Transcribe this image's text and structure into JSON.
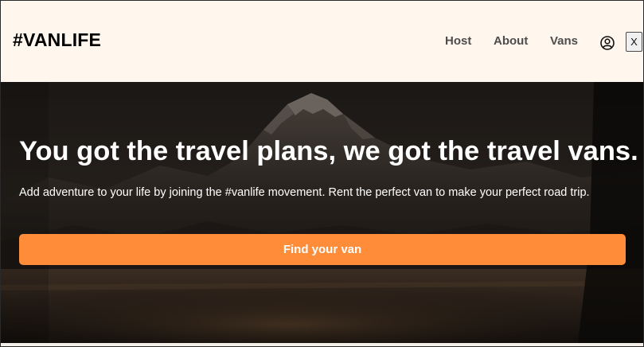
{
  "header": {
    "logo": "#VANLIFE",
    "nav": [
      {
        "label": "Host"
      },
      {
        "label": "About"
      },
      {
        "label": "Vans"
      }
    ],
    "user_icon": "user-circle-icon",
    "close_label": "X"
  },
  "hero": {
    "title": "You got the travel plans, we got the travel vans.",
    "subtitle": "Add adventure to your life by joining the #vanlife movement. Rent the perfect van to make your perfect road trip.",
    "cta_label": "Find your van"
  },
  "colors": {
    "header_bg": "#fff7ed",
    "accent": "#ff8c38",
    "nav_text": "#4d4d4d",
    "hero_text": "#ffffff"
  }
}
